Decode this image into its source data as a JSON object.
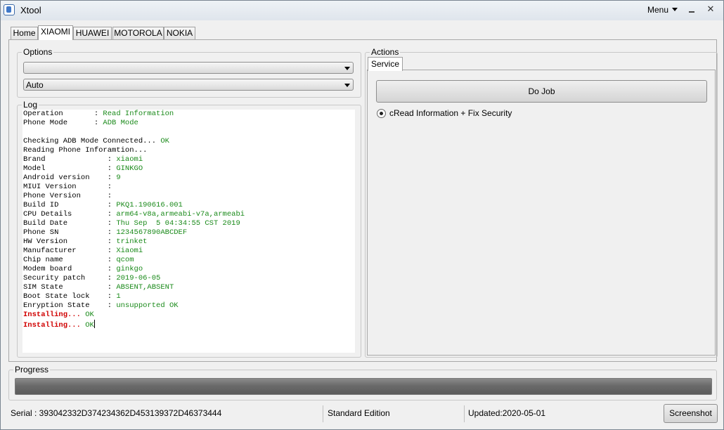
{
  "window": {
    "title": "Xtool",
    "menu_label": "Menu"
  },
  "tabs": [
    "Home",
    "XIAOMI",
    "HUAWEI",
    "MOTOROLA",
    "NOKIA"
  ],
  "options": {
    "label": "Options",
    "combo1_value": "",
    "combo2_value": "Auto"
  },
  "log": {
    "label": "Log",
    "lines": [
      [
        {
          "t": "Operation       : ",
          "c": ""
        },
        {
          "t": "Read Information",
          "c": "g"
        }
      ],
      [
        {
          "t": "Phone Mode      : ",
          "c": ""
        },
        {
          "t": "ADB Mode",
          "c": "g"
        }
      ],
      [],
      [
        {
          "t": "Checking ADB Mode Connected... ",
          "c": ""
        },
        {
          "t": "OK",
          "c": "g"
        }
      ],
      [
        {
          "t": "Reading Phone Inforamtion...",
          "c": ""
        }
      ],
      [
        {
          "t": "Brand              : ",
          "c": ""
        },
        {
          "t": "xiaomi",
          "c": "g"
        }
      ],
      [
        {
          "t": "Model              : ",
          "c": ""
        },
        {
          "t": "GINKGO",
          "c": "g"
        }
      ],
      [
        {
          "t": "Android version    : ",
          "c": ""
        },
        {
          "t": "9",
          "c": "g"
        }
      ],
      [
        {
          "t": "MIUI Version       :",
          "c": ""
        }
      ],
      [
        {
          "t": "Phone Version      :",
          "c": ""
        }
      ],
      [
        {
          "t": "Build ID           : ",
          "c": ""
        },
        {
          "t": "PKQ1.190616.001",
          "c": "g"
        }
      ],
      [
        {
          "t": "CPU Details        : ",
          "c": ""
        },
        {
          "t": "arm64-v8a,armeabi-v7a,armeabi",
          "c": "g"
        }
      ],
      [
        {
          "t": "Build Date         : ",
          "c": ""
        },
        {
          "t": "Thu Sep  5 04:34:55 CST 2019",
          "c": "g"
        }
      ],
      [
        {
          "t": "Phone SN           : ",
          "c": ""
        },
        {
          "t": "1234567890ABCDEF",
          "c": "g"
        }
      ],
      [
        {
          "t": "HW Version         : ",
          "c": ""
        },
        {
          "t": "trinket",
          "c": "g"
        }
      ],
      [
        {
          "t": "Manufacturer       : ",
          "c": ""
        },
        {
          "t": "Xiaomi",
          "c": "g"
        }
      ],
      [
        {
          "t": "Chip name          : ",
          "c": ""
        },
        {
          "t": "qcom",
          "c": "g"
        }
      ],
      [
        {
          "t": "Modem board        : ",
          "c": ""
        },
        {
          "t": "ginkgo",
          "c": "g"
        }
      ],
      [
        {
          "t": "Security patch     : ",
          "c": ""
        },
        {
          "t": "2019-06-05",
          "c": "g"
        }
      ],
      [
        {
          "t": "SIM State          : ",
          "c": ""
        },
        {
          "t": "ABSENT,ABSENT",
          "c": "g"
        }
      ],
      [
        {
          "t": "Boot State lock    : ",
          "c": ""
        },
        {
          "t": "1",
          "c": "g"
        }
      ],
      [
        {
          "t": "Enryption State    : ",
          "c": ""
        },
        {
          "t": "unsupported OK",
          "c": "g"
        }
      ],
      [
        {
          "t": "Installing... ",
          "c": "r"
        },
        {
          "t": "OK",
          "c": "g"
        }
      ],
      [
        {
          "t": "Installing... ",
          "c": "r"
        },
        {
          "t": "OK",
          "c": "g"
        }
      ]
    ]
  },
  "actions": {
    "label": "Actions",
    "tab_label": "Service",
    "do_job_label": "Do Job",
    "radio_label": "cRead Information + Fix Security"
  },
  "progress": {
    "label": "Progress",
    "fraction": 1.0
  },
  "status": {
    "serial": "Serial : 393042332D374234362D453139372D46373444",
    "edition": "Standard Edition",
    "updated": "Updated:2020-05-01",
    "screenshot_label": "Screenshot"
  },
  "colors": {
    "ok_green": "#1a8a1a",
    "installing_red": "#d00000"
  }
}
